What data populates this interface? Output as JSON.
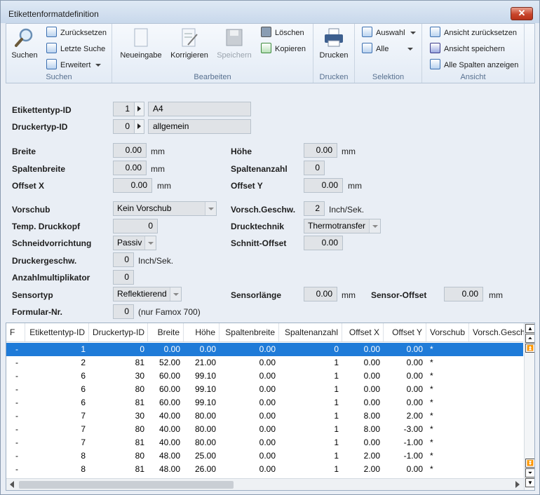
{
  "window": {
    "title": "Etikettenformatdefinition",
    "close_glyph": "✕"
  },
  "ribbon": {
    "suchen": {
      "label": "Suchen",
      "reset": "Zurücksetzen",
      "last": "Letzte Suche",
      "extended": "Erweitert",
      "group": "Suchen"
    },
    "bearbeiten": {
      "new": "Neueingabe",
      "edit": "Korrigieren",
      "save": "Speichern",
      "delete": "Löschen",
      "copy": "Kopieren",
      "group": "Bearbeiten"
    },
    "drucken": {
      "print": "Drucken",
      "group": "Drucken"
    },
    "selektion": {
      "auswahl": "Auswahl",
      "alle": "Alle",
      "group": "Selektion"
    },
    "ansicht": {
      "reset": "Ansicht zurücksetzen",
      "save": "Ansicht speichern",
      "show_all": "Alle Spalten anzeigen",
      "group": "Ansicht"
    }
  },
  "form": {
    "etikettentyp": {
      "label": "Etikettentyp-ID",
      "id": "1",
      "name": "A4"
    },
    "druckertyp": {
      "label": "Druckertyp-ID",
      "id": "0",
      "name": "allgemein"
    },
    "breite": {
      "label": "Breite",
      "value": "0.00",
      "unit": "mm"
    },
    "hoehe": {
      "label": "Höhe",
      "value": "0.00",
      "unit": "mm"
    },
    "spaltenbreite": {
      "label": "Spaltenbreite",
      "value": "0.00",
      "unit": "mm"
    },
    "spaltenanzahl": {
      "label": "Spaltenanzahl",
      "value": "0"
    },
    "offset_x": {
      "label": "Offset X",
      "value": "0.00",
      "unit": "mm"
    },
    "offset_y": {
      "label": "Offset Y",
      "value": "0.00",
      "unit": "mm"
    },
    "vorschub": {
      "label": "Vorschub",
      "value": "Kein Vorschub"
    },
    "vorsch_geschw": {
      "label": "Vorsch.Geschw.",
      "value": "2",
      "unit": "Inch/Sek."
    },
    "temp_druckkopf": {
      "label": "Temp. Druckkopf",
      "value": "0"
    },
    "drucktechnik": {
      "label": "Drucktechnik",
      "value": "Thermotransfer"
    },
    "schneidvorrichtung": {
      "label": "Schneidvorrichtung",
      "value": "Passiv"
    },
    "schnitt_offset": {
      "label": "Schnitt-Offset",
      "value": "0.00"
    },
    "druckergeschw": {
      "label": "Druckergeschw.",
      "value": "0",
      "unit": "Inch/Sek."
    },
    "anzahlmultiplikator": {
      "label": "Anzahlmultiplikator",
      "value": "0"
    },
    "sensortyp": {
      "label": "Sensortyp",
      "value": "Reflektierend"
    },
    "sensorlaenge": {
      "label": "Sensorlänge",
      "value": "0.00",
      "unit": "mm"
    },
    "sensor_offset": {
      "label": "Sensor-Offset",
      "value": "0.00",
      "unit": "mm"
    },
    "formular_nr": {
      "label": "Formular-Nr.",
      "value": "0",
      "note": "(nur Famox 700)"
    }
  },
  "grid": {
    "columns": [
      "F",
      "Etikettentyp-ID",
      "Druckertyp-ID",
      "Breite",
      "Höhe",
      "Spaltenbreite",
      "Spaltenanzahl",
      "Offset X",
      "Offset Y",
      "Vorschub",
      "Vorsch.Gesch"
    ],
    "rows": [
      [
        "-",
        "1",
        "0",
        "0.00",
        "0.00",
        "0.00",
        "0",
        "0.00",
        "0.00",
        "*"
      ],
      [
        "-",
        "2",
        "81",
        "52.00",
        "21.00",
        "0.00",
        "1",
        "0.00",
        "0.00",
        "*"
      ],
      [
        "-",
        "6",
        "30",
        "60.00",
        "99.10",
        "0.00",
        "1",
        "0.00",
        "0.00",
        "*"
      ],
      [
        "-",
        "6",
        "80",
        "60.00",
        "99.10",
        "0.00",
        "1",
        "0.00",
        "0.00",
        "*"
      ],
      [
        "-",
        "6",
        "81",
        "60.00",
        "99.10",
        "0.00",
        "1",
        "0.00",
        "0.00",
        "*"
      ],
      [
        "-",
        "7",
        "30",
        "40.00",
        "80.00",
        "0.00",
        "1",
        "8.00",
        "2.00",
        "*"
      ],
      [
        "-",
        "7",
        "80",
        "40.00",
        "80.00",
        "0.00",
        "1",
        "8.00",
        "-3.00",
        "*"
      ],
      [
        "-",
        "7",
        "81",
        "40.00",
        "80.00",
        "0.00",
        "1",
        "0.00",
        "-1.00",
        "*"
      ],
      [
        "-",
        "8",
        "80",
        "48.00",
        "25.00",
        "0.00",
        "1",
        "2.00",
        "-1.00",
        "*"
      ],
      [
        "-",
        "8",
        "81",
        "48.00",
        "26.00",
        "0.00",
        "1",
        "2.00",
        "0.00",
        "*"
      ]
    ],
    "selected_row": 0
  },
  "colors": {
    "selection": "#1f7bd8",
    "close": "#c7442b"
  }
}
